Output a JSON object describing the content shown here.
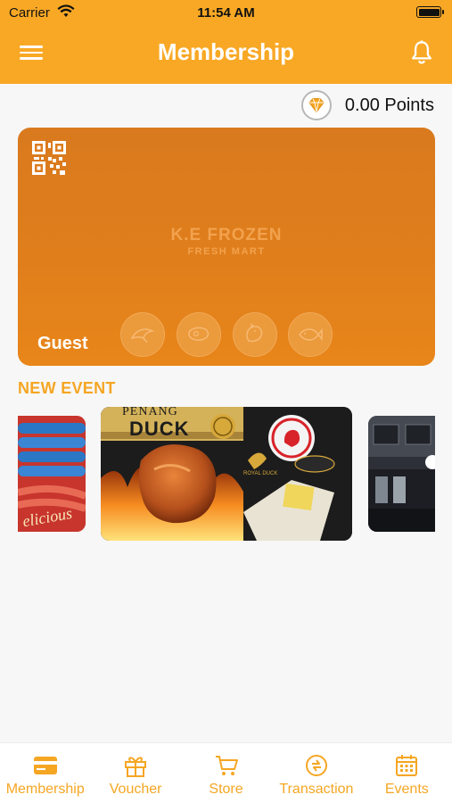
{
  "status_bar": {
    "carrier": "Carrier",
    "time": "11:54 AM"
  },
  "header": {
    "title": "Membership"
  },
  "points": {
    "text": "0.00 Points"
  },
  "card": {
    "brand": "K.E FROZEN",
    "brand_sub": "FRESH MART",
    "user": "Guest",
    "card_color": "#e07e1c"
  },
  "events": {
    "title": "NEW EVENT",
    "center_slide": {
      "line1": "PENANG",
      "line2": "DUCK",
      "brand": "ROYAL DUCK"
    }
  },
  "tabs": [
    {
      "label": "Membership",
      "icon": "membership-card-icon"
    },
    {
      "label": "Voucher",
      "icon": "gift-icon"
    },
    {
      "label": "Store",
      "icon": "cart-icon"
    },
    {
      "label": "Transaction",
      "icon": "transaction-icon"
    },
    {
      "label": "Events",
      "icon": "calendar-icon"
    }
  ],
  "colors": {
    "accent": "#f9a825",
    "tab_active": "#f5a623"
  }
}
